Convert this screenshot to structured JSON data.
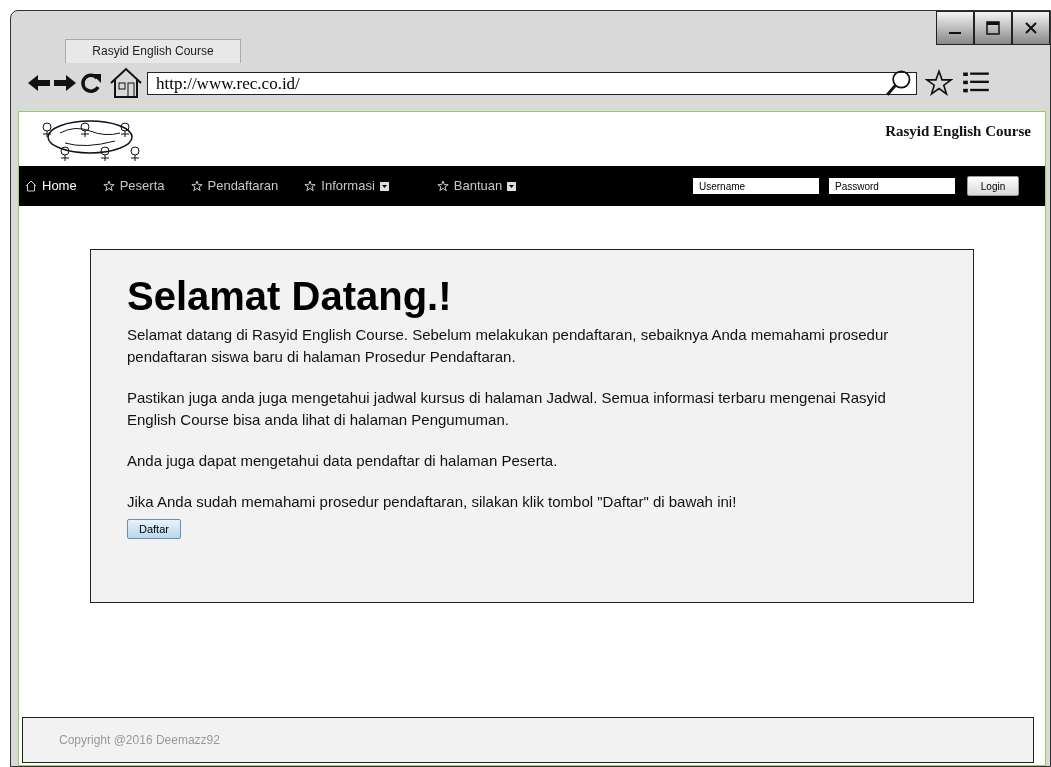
{
  "browser": {
    "tab": "Rasyid English Course",
    "url": "http://www.rec.co.id/"
  },
  "site": {
    "title": "Rasyid English Course"
  },
  "nav": [
    {
      "label": "Home",
      "kind": "home",
      "selected": true,
      "dropdown": false
    },
    {
      "label": "Peserta",
      "kind": "link",
      "selected": false,
      "dropdown": false
    },
    {
      "label": "Pendaftaran",
      "kind": "link",
      "selected": false,
      "dropdown": false
    },
    {
      "label": "Informasi",
      "kind": "link",
      "selected": false,
      "dropdown": true
    },
    {
      "label": "Bantuan",
      "kind": "link",
      "selected": false,
      "dropdown": true
    }
  ],
  "login": {
    "username_placeholder": "Username",
    "password_placeholder": "Password",
    "button": "Login"
  },
  "welcome": {
    "heading": "Selamat Datang.!",
    "paragraphs": [
      "Selamat datang di Rasyid English Course. Sebelum melakukan pendaftaran, sebaiknya Anda memahami prosedur pendaftaran siswa baru di halaman Prosedur Pendaftaran.",
      "Pastikan juga anda juga mengetahui jadwal kursus di halaman Jadwal. Semua informasi terbaru mengenai Rasyid English Course bisa anda lihat di halaman Pengumuman.",
      "Anda juga dapat mengetahui data pendaftar di halaman Peserta.",
      "Jika Anda sudah memahami prosedur pendaftaran, silakan klik tombol \"Daftar\" di bawah ini!"
    ],
    "button": "Daftar"
  },
  "footer": "Copyright @2016 Deemazz92"
}
